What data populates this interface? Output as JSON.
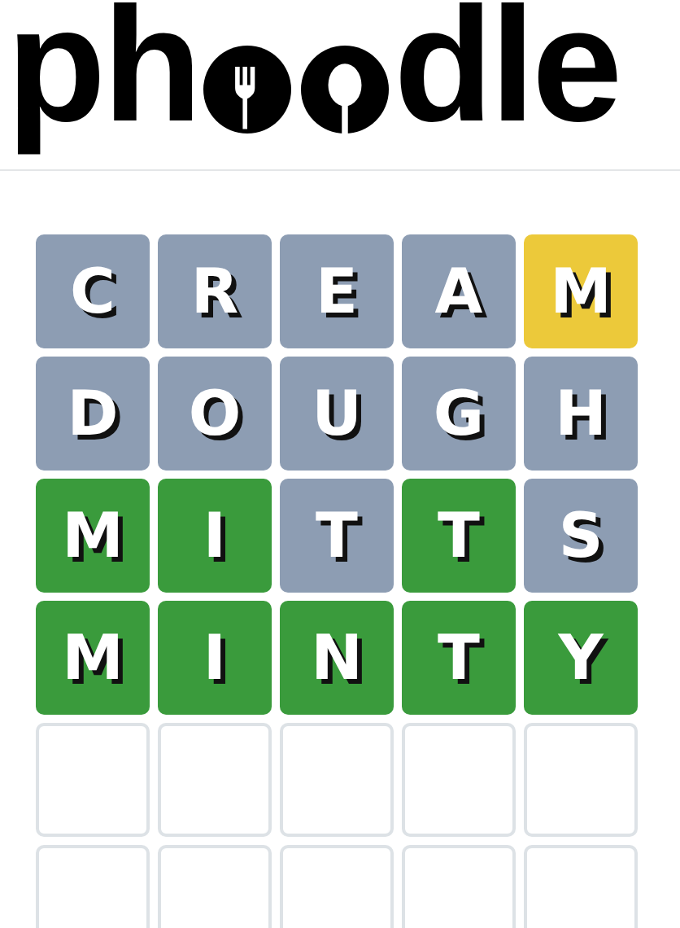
{
  "logo": {
    "start": "ph",
    "end": "dle"
  },
  "board": {
    "rows": [
      {
        "tiles": [
          {
            "letter": "C",
            "kind": "absent"
          },
          {
            "letter": "R",
            "kind": "absent"
          },
          {
            "letter": "E",
            "kind": "absent"
          },
          {
            "letter": "A",
            "kind": "absent"
          },
          {
            "letter": "M",
            "kind": "present"
          }
        ]
      },
      {
        "tiles": [
          {
            "letter": "D",
            "kind": "absent"
          },
          {
            "letter": "O",
            "kind": "absent"
          },
          {
            "letter": "U",
            "kind": "absent"
          },
          {
            "letter": "G",
            "kind": "absent"
          },
          {
            "letter": "H",
            "kind": "absent"
          }
        ]
      },
      {
        "tiles": [
          {
            "letter": "M",
            "kind": "correct"
          },
          {
            "letter": "I",
            "kind": "correct"
          },
          {
            "letter": "T",
            "kind": "absent"
          },
          {
            "letter": "T",
            "kind": "correct"
          },
          {
            "letter": "S",
            "kind": "absent"
          }
        ]
      },
      {
        "tiles": [
          {
            "letter": "M",
            "kind": "correct"
          },
          {
            "letter": "I",
            "kind": "correct"
          },
          {
            "letter": "N",
            "kind": "correct"
          },
          {
            "letter": "T",
            "kind": "correct"
          },
          {
            "letter": "Y",
            "kind": "correct"
          }
        ]
      },
      {
        "tiles": [
          {
            "kind": "empty"
          },
          {
            "kind": "empty"
          },
          {
            "kind": "empty"
          },
          {
            "kind": "empty"
          },
          {
            "kind": "empty"
          }
        ]
      },
      {
        "tiles": [
          {
            "kind": "empty"
          },
          {
            "kind": "empty"
          },
          {
            "kind": "empty"
          },
          {
            "kind": "empty"
          },
          {
            "kind": "empty"
          }
        ]
      }
    ]
  }
}
